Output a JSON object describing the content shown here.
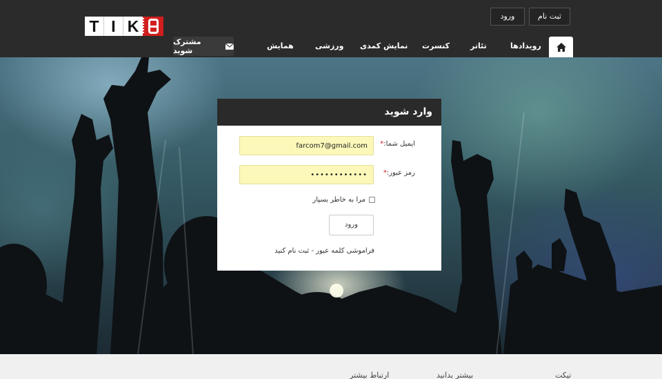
{
  "header": {
    "logo_letters": [
      "T",
      "I",
      "K"
    ],
    "register_label": "ثبت نام",
    "login_label": "ورود",
    "home_icon": "home-icon",
    "nav": {
      "events": "رویدادها",
      "theater": "تئاتر",
      "concert": "کنسرت",
      "comedy": "نمایش کمدی",
      "sport": "ورزشی",
      "conference": "همایش"
    },
    "subscribe_label": "مشترک شوید",
    "subscribe_icon": "envelope-icon"
  },
  "login": {
    "title": "وارد شوید",
    "email_label": "ایمیل شما:",
    "email_value": "farcom7@gmail.com",
    "password_label": "رمز عبور:",
    "password_value": "••••••••••••",
    "required_mark": "*",
    "remember_label": "مرا به خاطر بسپار",
    "submit_label": "ورود",
    "links_text": "فراموشی کلمه عبور - ثبت نام کنید"
  },
  "footer": {
    "col1": "تیکت",
    "col2": "بیشتر بدانید",
    "col3": "ارتباط بیشتر"
  },
  "colors": {
    "header_bg": "#2b2b2b",
    "accent_red": "#d11e1e",
    "autofill_yellow": "#fbf8b9"
  }
}
